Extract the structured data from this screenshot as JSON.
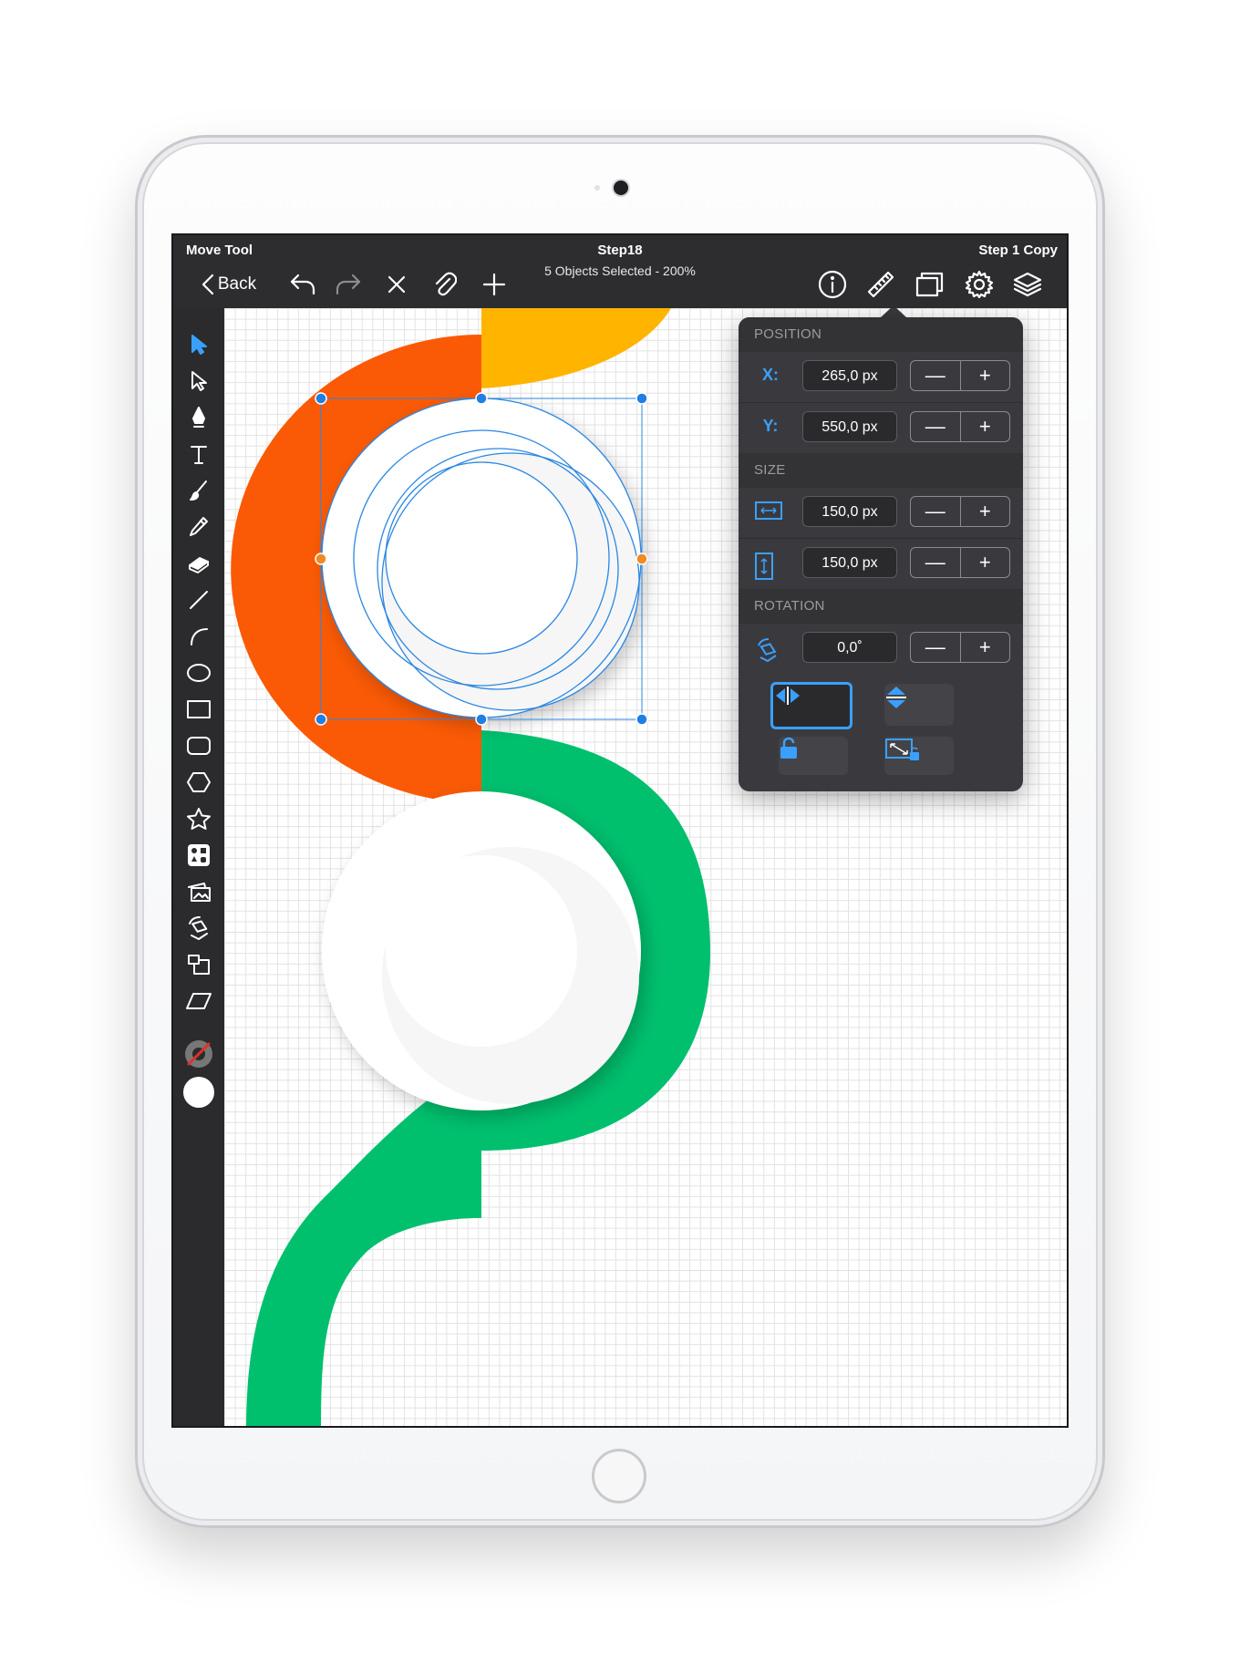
{
  "header": {
    "tool_name": "Move Tool",
    "document_title": "Step18",
    "status": "5 Objects Selected - 200%",
    "right_label": "Step 1 Copy",
    "back_label": "Back"
  },
  "toolbar_icons": [
    "undo-icon",
    "redo-icon",
    "close-icon",
    "paperclip-icon",
    "add-icon",
    "info-icon",
    "ruler-icon",
    "artboard-icon",
    "gear-icon",
    "layers-icon"
  ],
  "left_tools": [
    "move-arrow-icon",
    "direct-select-icon",
    "pen-icon",
    "text-icon",
    "brush-icon",
    "pencil-icon",
    "eraser-icon",
    "line-icon",
    "arc-icon",
    "ellipse-icon",
    "rectangle-icon",
    "rounded-rectangle-icon",
    "hexagon-icon",
    "star-icon",
    "shapes-library-icon",
    "image-stack-icon",
    "rotate-transform-icon",
    "scale-transform-icon",
    "skew-transform-icon",
    "stroke-color-icon",
    "fill-color-icon"
  ],
  "inspector": {
    "position_header": "POSITION",
    "x_label": "X:",
    "x_value": "265,0 px",
    "y_label": "Y:",
    "y_value": "550,0 px",
    "size_header": "SIZE",
    "width_value": "150,0 px",
    "height_value": "150,0 px",
    "rotation_header": "ROTATION",
    "rotation_value": "0,0˚",
    "minus": "—",
    "plus": "+"
  },
  "colors": {
    "accent": "#3aa0ff",
    "orange": "#fa5a05",
    "yellow": "#ffb400",
    "green": "#00c06e",
    "handle_orange": "#f08a24",
    "fill_swatch": "#ffffff"
  }
}
